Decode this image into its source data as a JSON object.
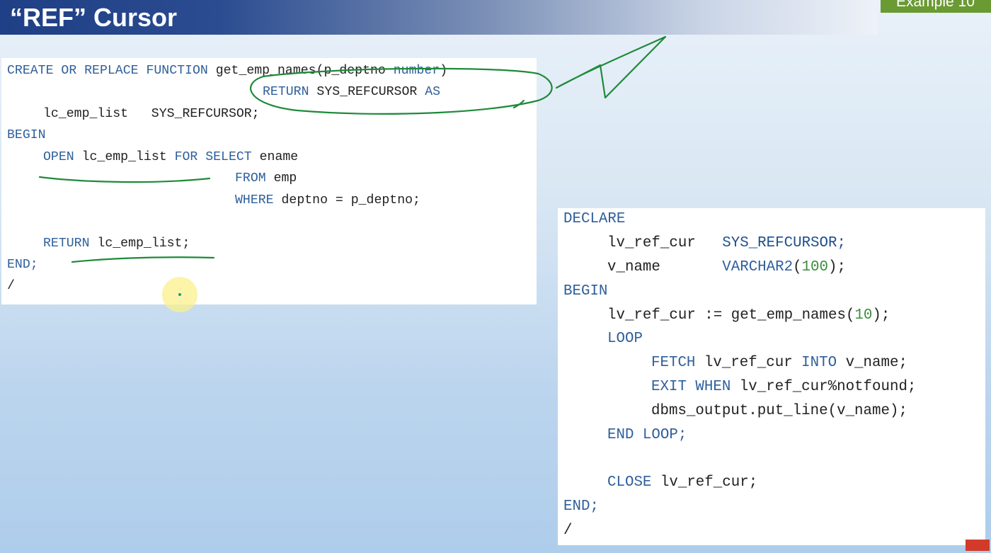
{
  "slide": {
    "title": "“REF” Cursor",
    "example_label": "Example 10"
  },
  "function_code": {
    "line1": {
      "kw": "CREATE OR REPLACE FUNCTION",
      "rest": " get_emp_names(p_deptno ",
      "type": "number",
      "close": ")"
    },
    "line2": {
      "kw1": "RETURN",
      "mid": " SYS_REFCURSOR ",
      "kw2": "AS"
    },
    "line3": "lc_emp_list   SYS_REFCURSOR;",
    "line4": "BEGIN",
    "line5": {
      "kw1": "OPEN",
      "mid1": " lc_emp_list ",
      "kw2": "FOR SELECT",
      "rest": " ename"
    },
    "line6": {
      "kw": "FROM",
      "rest": " emp"
    },
    "line7": {
      "kw": "WHERE",
      "rest": " deptno = p_deptno;"
    },
    "line8": {
      "kw": "RETURN",
      "rest": " lc_emp_list;"
    },
    "line9": "END;",
    "line10": "/"
  },
  "block_code": {
    "line1": "DECLARE",
    "line2": {
      "name": "lv_ref_cur   ",
      "type": "SYS_REFCURSOR;"
    },
    "line3": {
      "name": "v_name       ",
      "type": "VARCHAR2",
      "open": "(",
      "num": "100",
      "close": ");"
    },
    "line4": "BEGIN",
    "line5": {
      "rest": "lv_ref_cur := get_emp_names(",
      "num": "10",
      "close": ");"
    },
    "line6": "LOOP",
    "line7": {
      "kw1": "FETCH",
      "mid": " lv_ref_cur ",
      "kw2": "INTO",
      "rest": " v_name;"
    },
    "line8": {
      "kw": "EXIT WHEN",
      "rest": " lv_ref_cur%notfound;"
    },
    "line9": "dbms_output.put_line(v_name);",
    "line10": "END LOOP;",
    "line11": {
      "kw": "CLOSE",
      "rest": " lv_ref_cur;"
    },
    "line12": "END;",
    "line13": "/"
  },
  "colors": {
    "keyword": "#2f5f9c",
    "number": "#3c8d3c",
    "annotation": "#1e8a3a",
    "badge": "#6a9a32"
  }
}
